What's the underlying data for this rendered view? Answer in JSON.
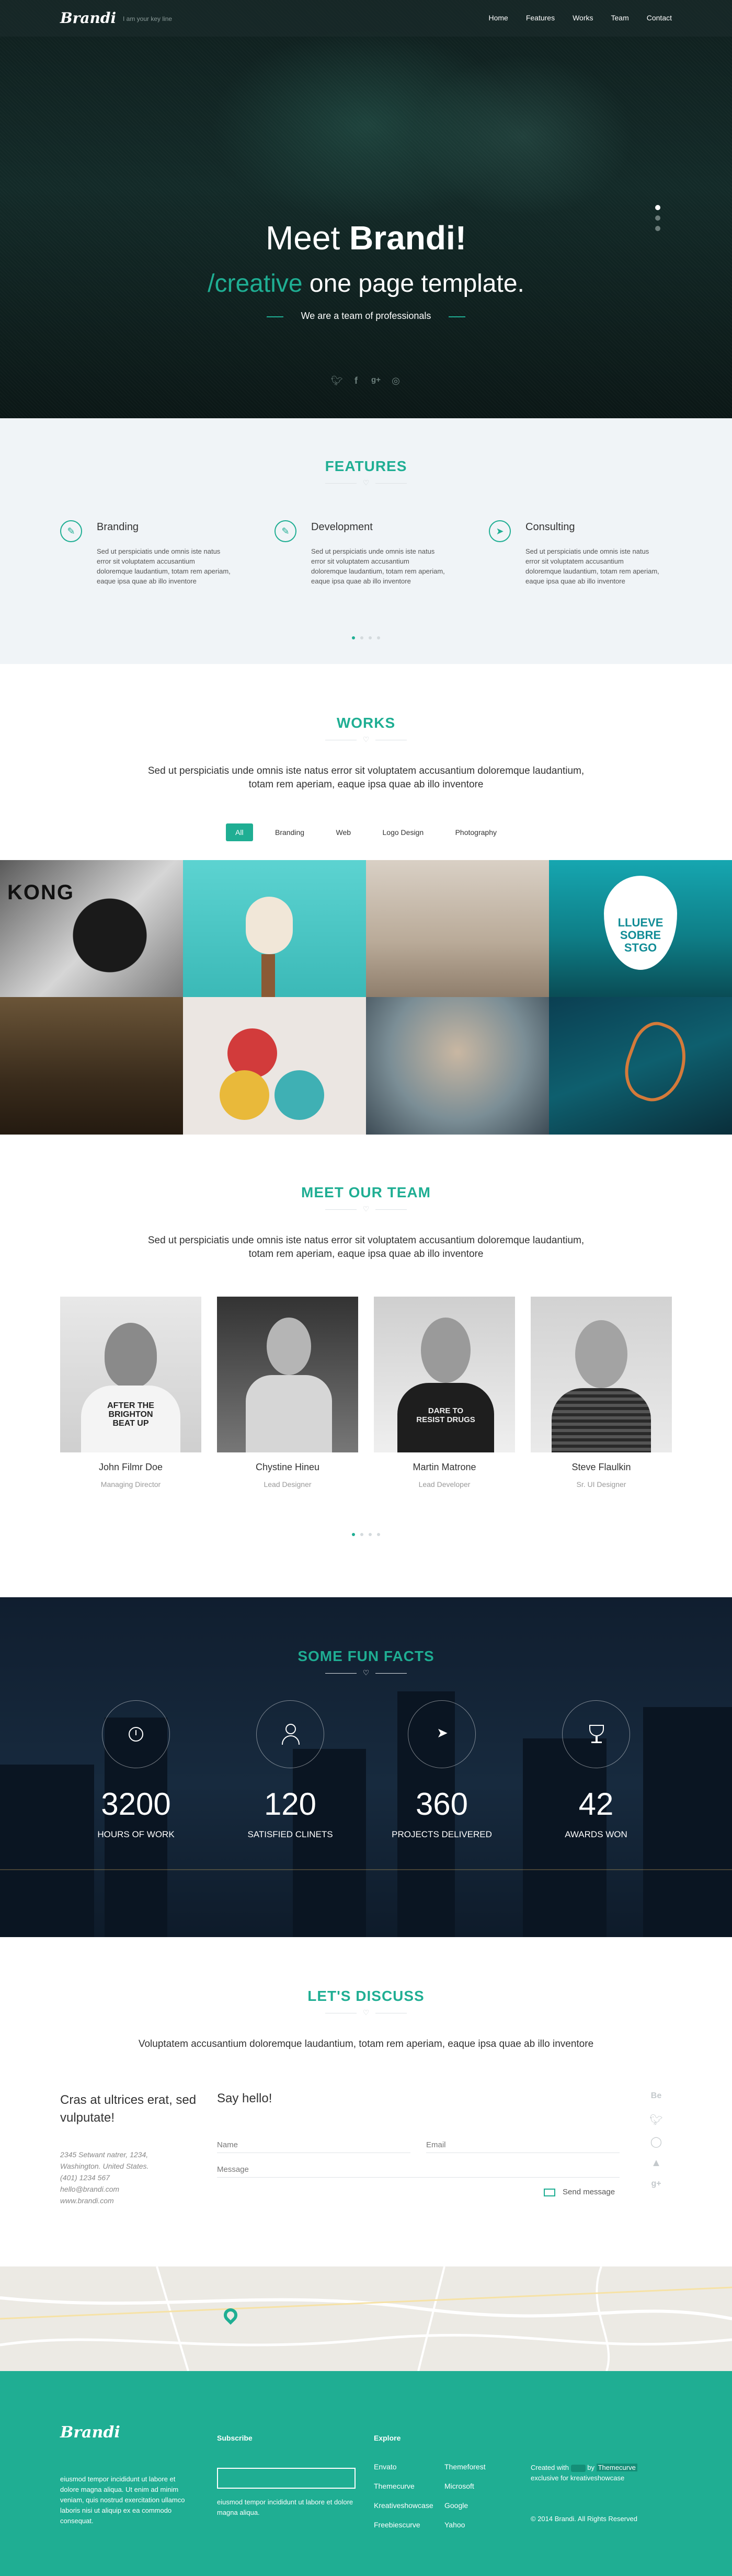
{
  "nav": {
    "logo": "Brandi",
    "tagline": "I am your key line",
    "links": [
      "Home",
      "Features",
      "Works",
      "Team",
      "Contact"
    ]
  },
  "hero": {
    "title_pre": "Meet ",
    "title_bold": "Brandi!",
    "sub_accent": "/creative",
    "sub_rest": " one page template.",
    "small": "We are a team of professionals",
    "social_icons": [
      "twitter-icon",
      "facebook-icon",
      "google-plus-icon",
      "pinterest-icon"
    ]
  },
  "features": {
    "title": "FEATURES",
    "items": [
      {
        "icon": "pencil-icon",
        "title": "Branding",
        "text": "Sed ut perspiciatis unde omnis iste natus error sit voluptatem accusantium doloremque laudantium, totam rem aperiam, eaque ipsa quae ab illo inventore"
      },
      {
        "icon": "pencil-icon",
        "title": "Development",
        "text": "Sed ut perspiciatis unde omnis iste natus error sit voluptatem accusantium doloremque laudantium, totam rem aperiam, eaque ipsa quae ab illo inventore"
      },
      {
        "icon": "rocket-icon",
        "title": "Consulting",
        "text": "Sed ut perspiciatis unde omnis iste natus error sit voluptatem accusantium doloremque laudantium, totam rem aperiam, eaque ipsa quae ab illo inventore"
      }
    ]
  },
  "works": {
    "title": "WORKS",
    "lead1": "Sed ut perspiciatis unde omnis iste natus error sit voluptatem accusantium doloremque laudantium,",
    "lead2": "totam rem aperiam, eaque ipsa quae ab illo inventore",
    "filters": [
      "All",
      "Branding",
      "Web",
      "Logo Design",
      "Photography"
    ],
    "tiles": [
      "KONG",
      "",
      "",
      "",
      "",
      "",
      "",
      "",
      ""
    ],
    "poster": {
      "l1": "LLUEVE",
      "l2": "SOBRE",
      "l3": "STGO"
    }
  },
  "team": {
    "title": "MEET OUR TEAM",
    "lead1": "Sed ut perspiciatis unde omnis iste natus error sit voluptatem accusantium doloremque laudantium,",
    "lead2": "totam rem aperiam, eaque ipsa quae ab illo inventore",
    "members": [
      {
        "name": "John Filmr Doe",
        "role": "Managing Director",
        "shirt": "AFTER THE BRIGHTON BEAT UP"
      },
      {
        "name": "Chystine Hineu",
        "role": "Lead Designer",
        "shirt": ""
      },
      {
        "name": "Martin Matrone",
        "role": "Lead Developer",
        "shirt": "DARE TO RESIST DRUGS"
      },
      {
        "name": "Steve Flaulkin",
        "role": "Sr. UI Designer",
        "shirt": ""
      }
    ]
  },
  "facts": {
    "title": "SOME FUN FACTS",
    "items": [
      {
        "icon": "clock-icon",
        "value": "3200",
        "label": "HOURS OF WORK"
      },
      {
        "icon": "user-icon",
        "value": "120",
        "label": "SATISFIED CLINETS"
      },
      {
        "icon": "rocket-icon",
        "value": "360",
        "label": "PROJECTS DELIVERED"
      },
      {
        "icon": "trophy-icon",
        "value": "42",
        "label": "AWARDS WON"
      }
    ]
  },
  "discuss": {
    "title": "LET'S DISCUSS",
    "lead": "Voluptatem accusantium doloremque laudantium, totam rem aperiam, eaque ipsa quae ab illo inventore",
    "heading": "Cras at ultrices erat, sed vulputate!",
    "address": [
      "2345 Setwant natrer, 1234,",
      "Washington. United States.",
      "(401) 1234 567",
      "hello@brandi.com",
      "www.brandi.com"
    ],
    "form_title": "Say hello!",
    "name_ph": "Name",
    "email_ph": "Email",
    "message_ph": "Message",
    "send": "Send message",
    "side_icons": [
      "behance-icon",
      "twitter-icon",
      "dribbble-icon",
      "flickr-icon",
      "google-plus-icon"
    ]
  },
  "footer": {
    "logo": "Brandi",
    "about": "eiusmod tempor incididunt ut labore et dolore magna aliqua. Ut enim ad minim veniam, quis nostrud exercitation ullamco laboris nisi ut aliquip ex ea commodo consequat.",
    "subscribe_title": "Subscribe",
    "subscribe_text": "eiusmod tempor incididunt ut labore et dolore magna aliqua.",
    "explore_title": "Explore",
    "links_col1": [
      "Envato",
      "Themecurve",
      "Kreativeshowcase",
      "Freebiescurve"
    ],
    "links_col2": [
      "Themeforest",
      "Microsoft",
      "Google",
      "Yahoo"
    ],
    "created_pre": "Created with",
    "created_by": "by",
    "created_brand": "Themecurve",
    "created_post": "exclusive for kreativeshowcase",
    "copyright": "© 2014 Brandi. All Rights Reserved"
  },
  "colors": {
    "accent": "#1fae93",
    "hero_bg": "#0f1f1e",
    "facts_bg": "#101e2f",
    "footer_bg": "#1fae93"
  }
}
